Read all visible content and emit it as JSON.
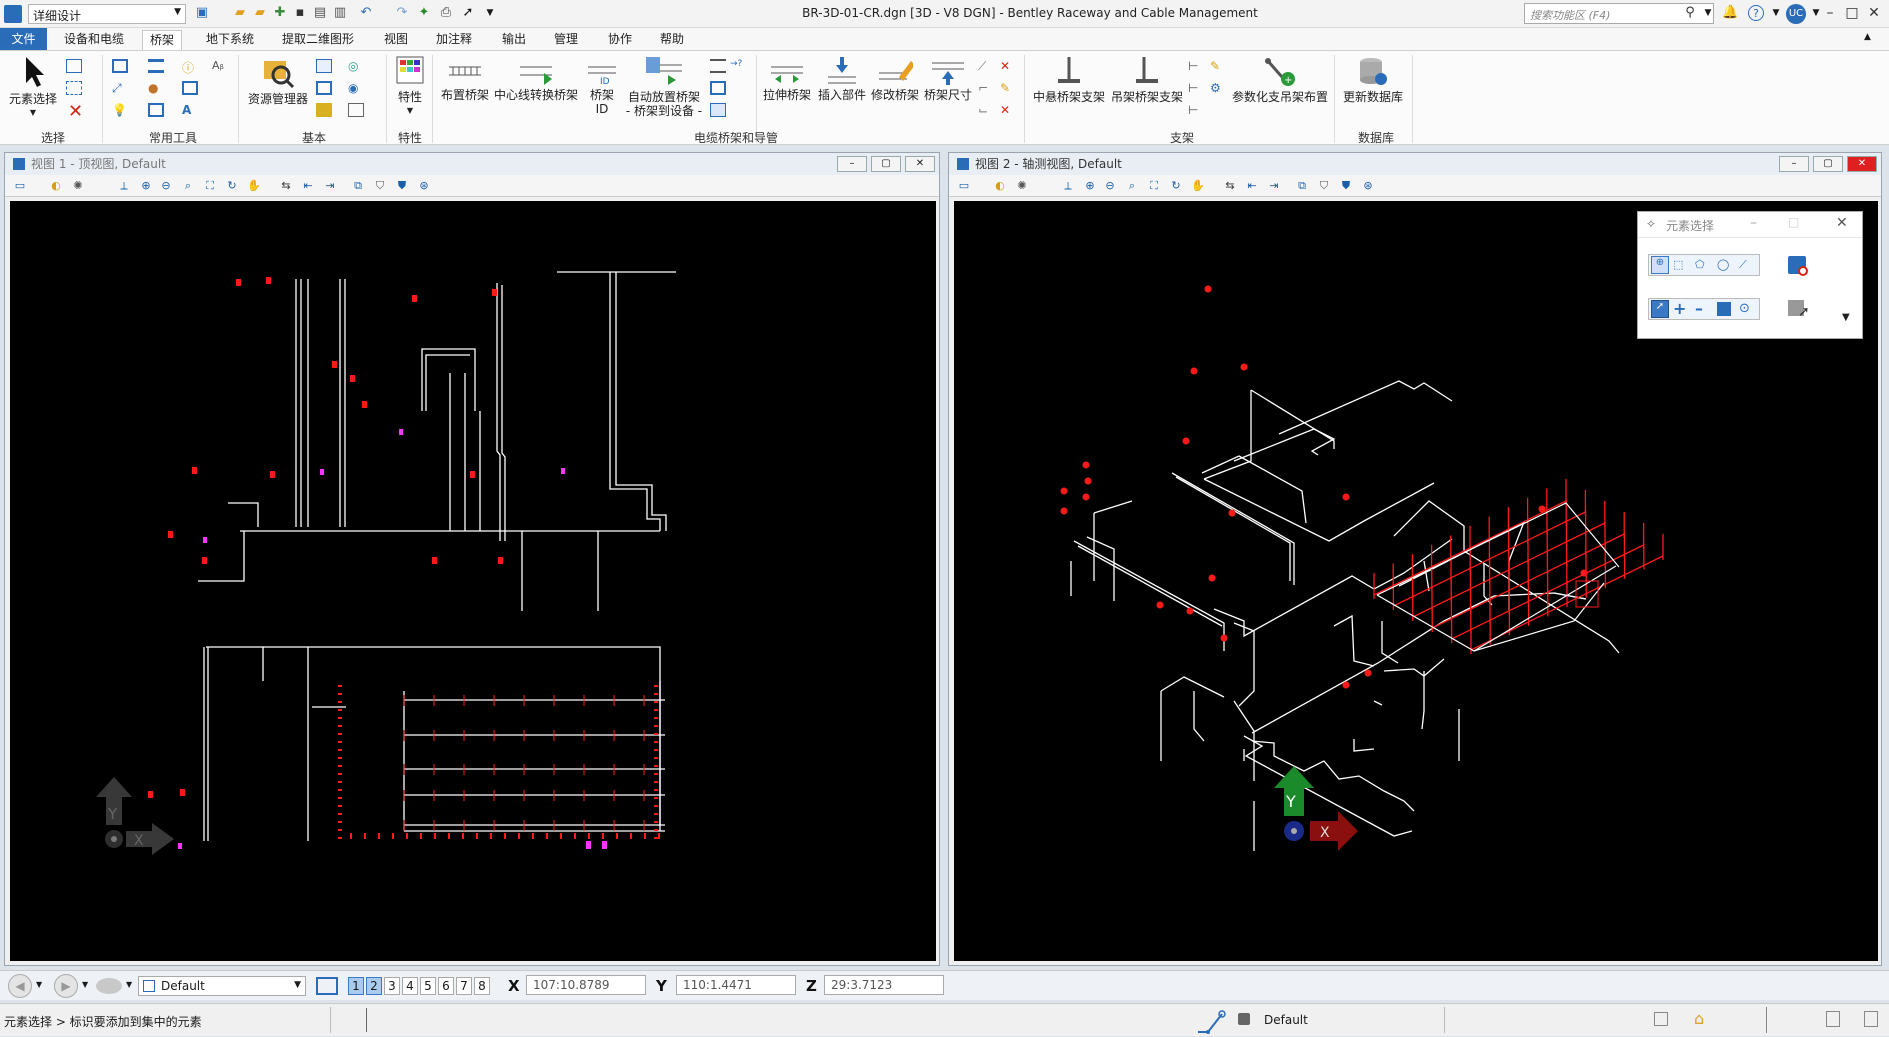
{
  "app": {
    "title": "BR-3D-01-CR.dgn [3D - V8 DGN] - Bentley Raceway and Cable Management",
    "workspace": "详细设计",
    "search_placeholder": "搜索功能区 (F4)",
    "user_badge": "UC"
  },
  "menu": [
    "文件",
    "设备和电缆",
    "桥架",
    "地下系统",
    "提取二维图形",
    "视图",
    "加注释",
    "输出",
    "管理",
    "协作",
    "帮助"
  ],
  "ribbon": {
    "groups": [
      "选择",
      "常用工具",
      "基本",
      "特性",
      "电缆桥架和导管",
      "支架",
      "数据库"
    ],
    "buttons": {
      "element_select": "元素选择",
      "resource_manager": "资源管理器",
      "properties": "特性",
      "place_tray": "布置桥架",
      "centerline_tray": "中心线转换桥架",
      "tray_id_top": "桥架",
      "tray_id_bottom": "ID",
      "auto_place_top": "自动放置桥架",
      "auto_place_bottom": "- 桥架到设备 -",
      "stretch_tray": "拉伸桥架",
      "insert_part": "插入部件",
      "modify_tray": "修改桥架",
      "tray_size": "桥架尺寸",
      "hanger_support": "中悬桥架支架",
      "hang_support": "吊架桥架支架",
      "param_support": "参数化支吊架布置",
      "update_db": "更新数据库"
    }
  },
  "views": {
    "view1_title": "视图 1 - 顶视图, Default",
    "view2_title": "视图 2 - 轴测视图, Default"
  },
  "element_select_dialog": {
    "title": "元素选择"
  },
  "status": {
    "level": "Default",
    "view_numbers": [
      "1",
      "2",
      "3",
      "4",
      "5",
      "6",
      "7",
      "8"
    ],
    "x_label": "X",
    "x_value": "107:10.8789",
    "y_label": "Y",
    "y_value": "110:1.4471",
    "z_label": "Z",
    "z_value": "29:3.7123",
    "prompt": "元素选择 > 标识要添加到集中的元素",
    "active_model": "Default"
  },
  "axes": {
    "y": "Y",
    "x": "X"
  },
  "colors": {
    "accent": "#2b6cb8",
    "canvas": "#000000",
    "geometry": "#ffffff",
    "marker": "#ff1a1a",
    "marker_alt": "#ff33ff",
    "axis_y_dim": "#5a5a5a",
    "axis_y": "#1a8a2a",
    "axis_x": "#8a1010"
  }
}
